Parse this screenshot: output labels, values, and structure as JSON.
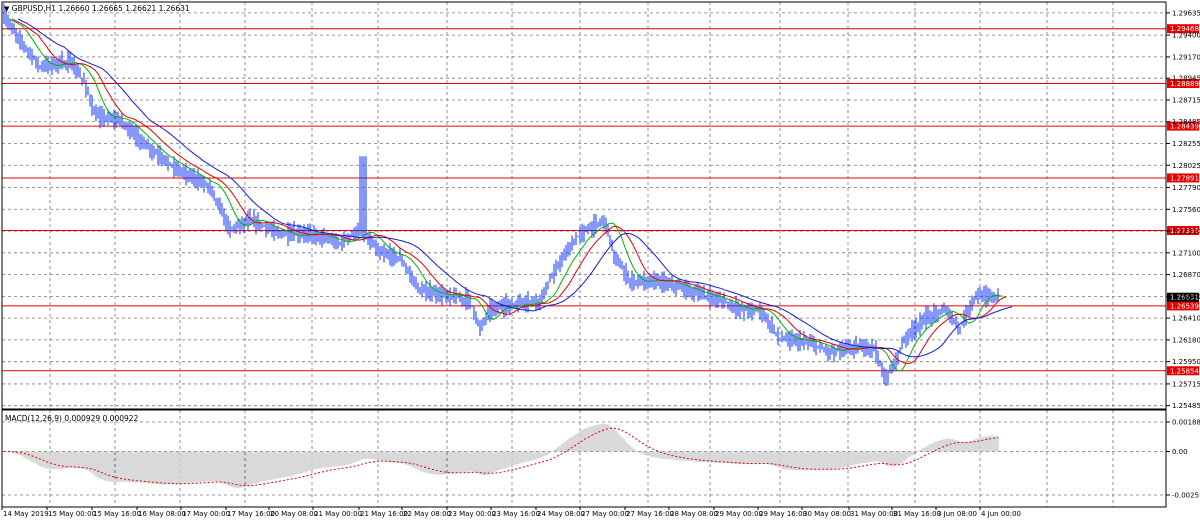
{
  "main_header": {
    "label": "GBPUSD,H1  1.26660 1.26665 1.26621 1.26631",
    "arrow": "▼"
  },
  "macd_header": {
    "label": "MACD(12,26,9) 0.000929 0.000922"
  },
  "price_axis": {
    "ticks": [
      "1.29635",
      "1.29400",
      "1.29170",
      "1.28945",
      "1.28715",
      "1.28485",
      "1.28255",
      "1.28025",
      "1.27790",
      "1.27560",
      "1.27330",
      "1.27100",
      "1.26870",
      "1.26640",
      "1.26410",
      "1.26180",
      "1.25950",
      "1.25715",
      "1.25485"
    ],
    "min": 1.2545,
    "max": 1.2975
  },
  "h_levels": [
    {
      "price": "1.29468",
      "value": 1.29468
    },
    {
      "price": "1.28889",
      "value": 1.28889
    },
    {
      "price": "1.28439",
      "value": 1.28439
    },
    {
      "price": "1.27891",
      "value": 1.27891
    },
    {
      "price": "1.27336",
      "value": 1.27336
    },
    {
      "price": "1.26539",
      "value": 1.26539
    },
    {
      "price": "1.25854",
      "value": 1.25854
    }
  ],
  "current_price": {
    "label": "1.26631",
    "value": 1.26631
  },
  "macd_axis": {
    "ticks": [
      "0.001882",
      "0.00",
      "-0.002516"
    ]
  },
  "time_axis": [
    "14 May 2019",
    "15 May 00:00",
    "15 May 16:00",
    "16 May 08:00",
    "17 May 00:00",
    "17 May 16:00",
    "20 May 08:00",
    "21 May 00:00",
    "21 May 16:00",
    "22 May 08:00",
    "23 May 00:00",
    "23 May 16:00",
    "24 May 08:00",
    "27 May 00:00",
    "27 May 16:00",
    "28 May 08:00",
    "29 May 00:00",
    "29 May 16:00",
    "30 May 08:00",
    "31 May 00:00",
    "31 May 16:00",
    "3 Jun 08:00",
    "4 Jun 00:00"
  ],
  "colors": {
    "price": "#0a32ff",
    "fast_ma": "#00b400",
    "mid_ma": "#e60000",
    "slow_ma": "#1a1ad6",
    "level": "#e60000",
    "macd_hist": "#a0a0a0",
    "macd_signal": "#e60000",
    "grid": "#777777"
  },
  "chart_data": {
    "type": "line",
    "title": "GBPUSD,H1",
    "series": [
      {
        "name": "GBPUSD,H1",
        "x": [
          "14 May 2019",
          "15 May 00:00",
          "15 May 16:00",
          "16 May 08:00",
          "17 May 00:00",
          "17 May 16:00",
          "20 May 08:00",
          "21 May 00:00",
          "21 May 16:00",
          "22 May 08:00",
          "23 May 00:00",
          "23 May 16:00",
          "24 May 08:00",
          "27 May 00:00",
          "27 May 16:00",
          "28 May 08:00",
          "29 May 00:00",
          "29 May 16:00",
          "30 May 08:00",
          "31 May 00:00",
          "31 May 16:00",
          "3 Jun 08:00",
          "4 Jun 00:00"
        ],
        "values": [
          1.2955,
          1.2912,
          1.285,
          1.283,
          1.279,
          1.2735,
          1.2745,
          1.2725,
          1.2705,
          1.267,
          1.2645,
          1.265,
          1.266,
          1.274,
          1.268,
          1.267,
          1.2655,
          1.264,
          1.2625,
          1.261,
          1.263,
          1.264,
          1.2663
        ]
      }
    ],
    "macd": {
      "label": "MACD(12,26,9)",
      "main": 0.000929,
      "signal": 0.000922,
      "ylim": [
        -0.002516,
        0.001882
      ]
    },
    "ylim": [
      1.25485,
      1.29635
    ],
    "grid": true
  }
}
